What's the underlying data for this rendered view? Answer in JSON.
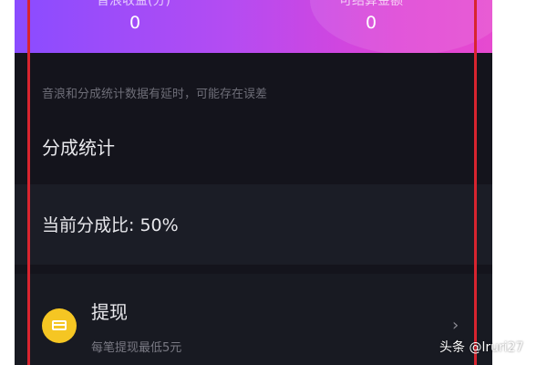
{
  "header": {
    "stats": [
      {
        "label": "音浪收益(分)",
        "value": "0"
      },
      {
        "label": "可结算金额",
        "value": "0"
      }
    ]
  },
  "notice": "音浪和分成统计数据有延时，可能存在误差",
  "section_title": "分成统计",
  "ratio": {
    "text": "当前分成比: 50%"
  },
  "withdraw": {
    "title": "提现",
    "subtitle": "每笔提现最低5元",
    "icon": "wallet-icon",
    "chevron": "›"
  },
  "watermark": "头条 @lruri27",
  "colors": {
    "header_gradient_start": "#8a4cff",
    "header_gradient_end": "#e64ad0",
    "background": "#14141c",
    "wallet_icon": "#f5c623",
    "annotation_line": "#d8242f"
  }
}
